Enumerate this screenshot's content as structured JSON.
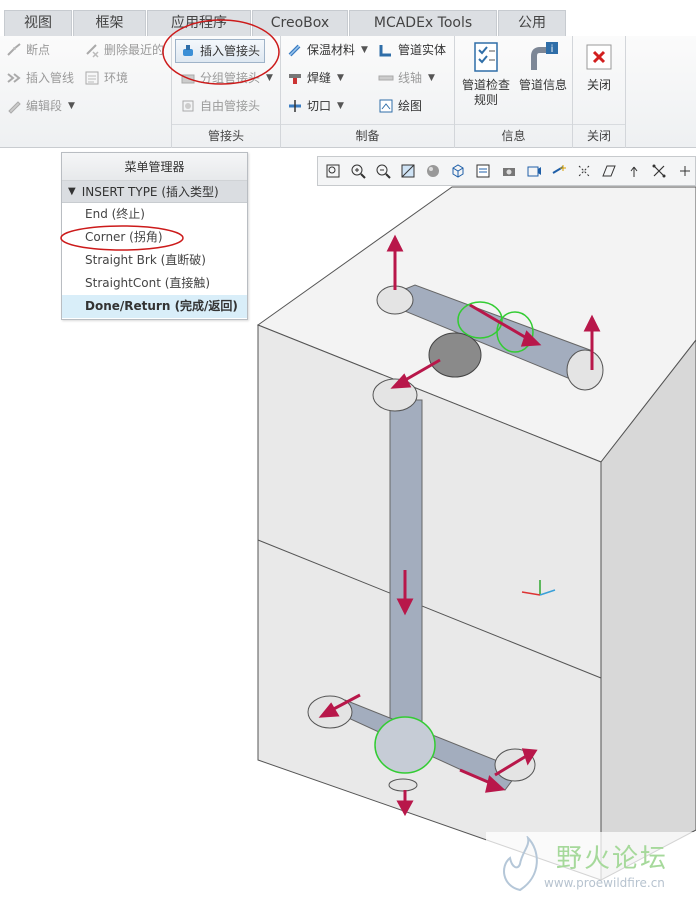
{
  "tabs": [
    "视图",
    "框架",
    "应用程序",
    "CreoBox",
    "MCADEx Tools",
    "公用"
  ],
  "ribbon": {
    "left_group": {
      "items": [
        {
          "label": "断点",
          "icon": "break-point-icon",
          "disabled": true
        },
        {
          "label": "删除最近的",
          "icon": "delete-recent-icon",
          "disabled": true
        },
        {
          "label": "插入管线",
          "icon": "insert-pipeline-icon",
          "disabled": true
        },
        {
          "label": "环境",
          "icon": "environment-icon",
          "disabled": true
        },
        {
          "label": "编辑段",
          "icon": "edit-segment-icon",
          "disabled": true
        }
      ]
    },
    "fitting_group": {
      "label": "管接头",
      "insert": "插入管接头",
      "group": "分组管接头",
      "free": "自由管接头"
    },
    "fab_group": {
      "label": "制备",
      "insulation": "保温材料",
      "weld": "焊缝",
      "cut": "切口",
      "solid": "管道实体",
      "axis": "线轴",
      "drawing": "绘图"
    },
    "info_group": {
      "label": "信息",
      "check": "管道检查规则",
      "info": "管道信息"
    },
    "close_group": {
      "label": "关闭",
      "close": "关闭"
    }
  },
  "menu_manager": {
    "title": "菜单管理器",
    "section": "INSERT TYPE (插入类型)",
    "items": [
      "End (终止)",
      "Corner (拐角)",
      "Straight Brk (直断破)",
      "StraightCont (直接触)",
      "Done/Return (完成/返回)"
    ]
  },
  "watermark": {
    "title": "野火论坛",
    "url": "www.proewildfire.cn"
  },
  "colors": {
    "accent": "#cc1a1a",
    "pipe": "#9aa5b8",
    "wall": "#ebebeb",
    "fitting_highlight": "#33cc33",
    "arrow": "#b8174a"
  }
}
